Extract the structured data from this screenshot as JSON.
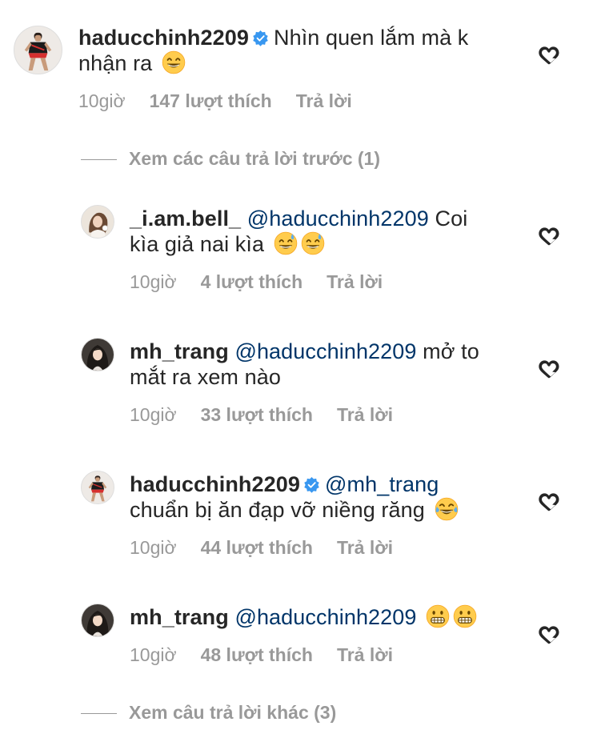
{
  "main_comment": {
    "username": "haducchinh2209",
    "text_line1": "Nhìn quen lắm mà k",
    "text_line2": "nhận ra",
    "emoji": "grinning-face-with-smiling-eyes",
    "time": "10giờ",
    "likes": "147 lượt thích",
    "reply": "Trả lời"
  },
  "view_previous": "Xem các câu trả lời trước (1)",
  "replies": [
    {
      "username": "_i.am.bell_",
      "mention": "@haducchinh2209",
      "text_line1": "Coi",
      "text_line2": "kìa giả nai kìa",
      "emojis": [
        "grinning-face-with-sweat",
        "grinning-face-with-sweat"
      ],
      "time": "10giờ",
      "likes": "4 lượt thích",
      "reply": "Trả lời"
    },
    {
      "username": "mh_trang",
      "mention": "@haducchinh2209",
      "text_line1": "mở to",
      "text_line2": "mắt ra xem nào",
      "time": "10giờ",
      "likes": "33 lượt thích",
      "reply": "Trả lời"
    },
    {
      "username": "haducchinh2209",
      "mention": "@mh_trang",
      "text_line2": "chuẩn bị ăn đạp vỡ niềng răng",
      "emojis": [
        "face-with-tears-of-joy"
      ],
      "time": "10giờ",
      "likes": "44 lượt thích",
      "reply": "Trả lời"
    },
    {
      "username": "mh_trang",
      "mention": "@haducchinh2209",
      "emojis": [
        "grimacing-face",
        "grimacing-face"
      ],
      "time": "10giờ",
      "likes": "48 lượt thích",
      "reply": "Trả lời"
    }
  ],
  "view_more": "Xem câu trả lời khác (3)",
  "colors": {
    "text": "#262626",
    "secondary": "#999999",
    "mention": "#003569",
    "verified": "#3897f0"
  }
}
